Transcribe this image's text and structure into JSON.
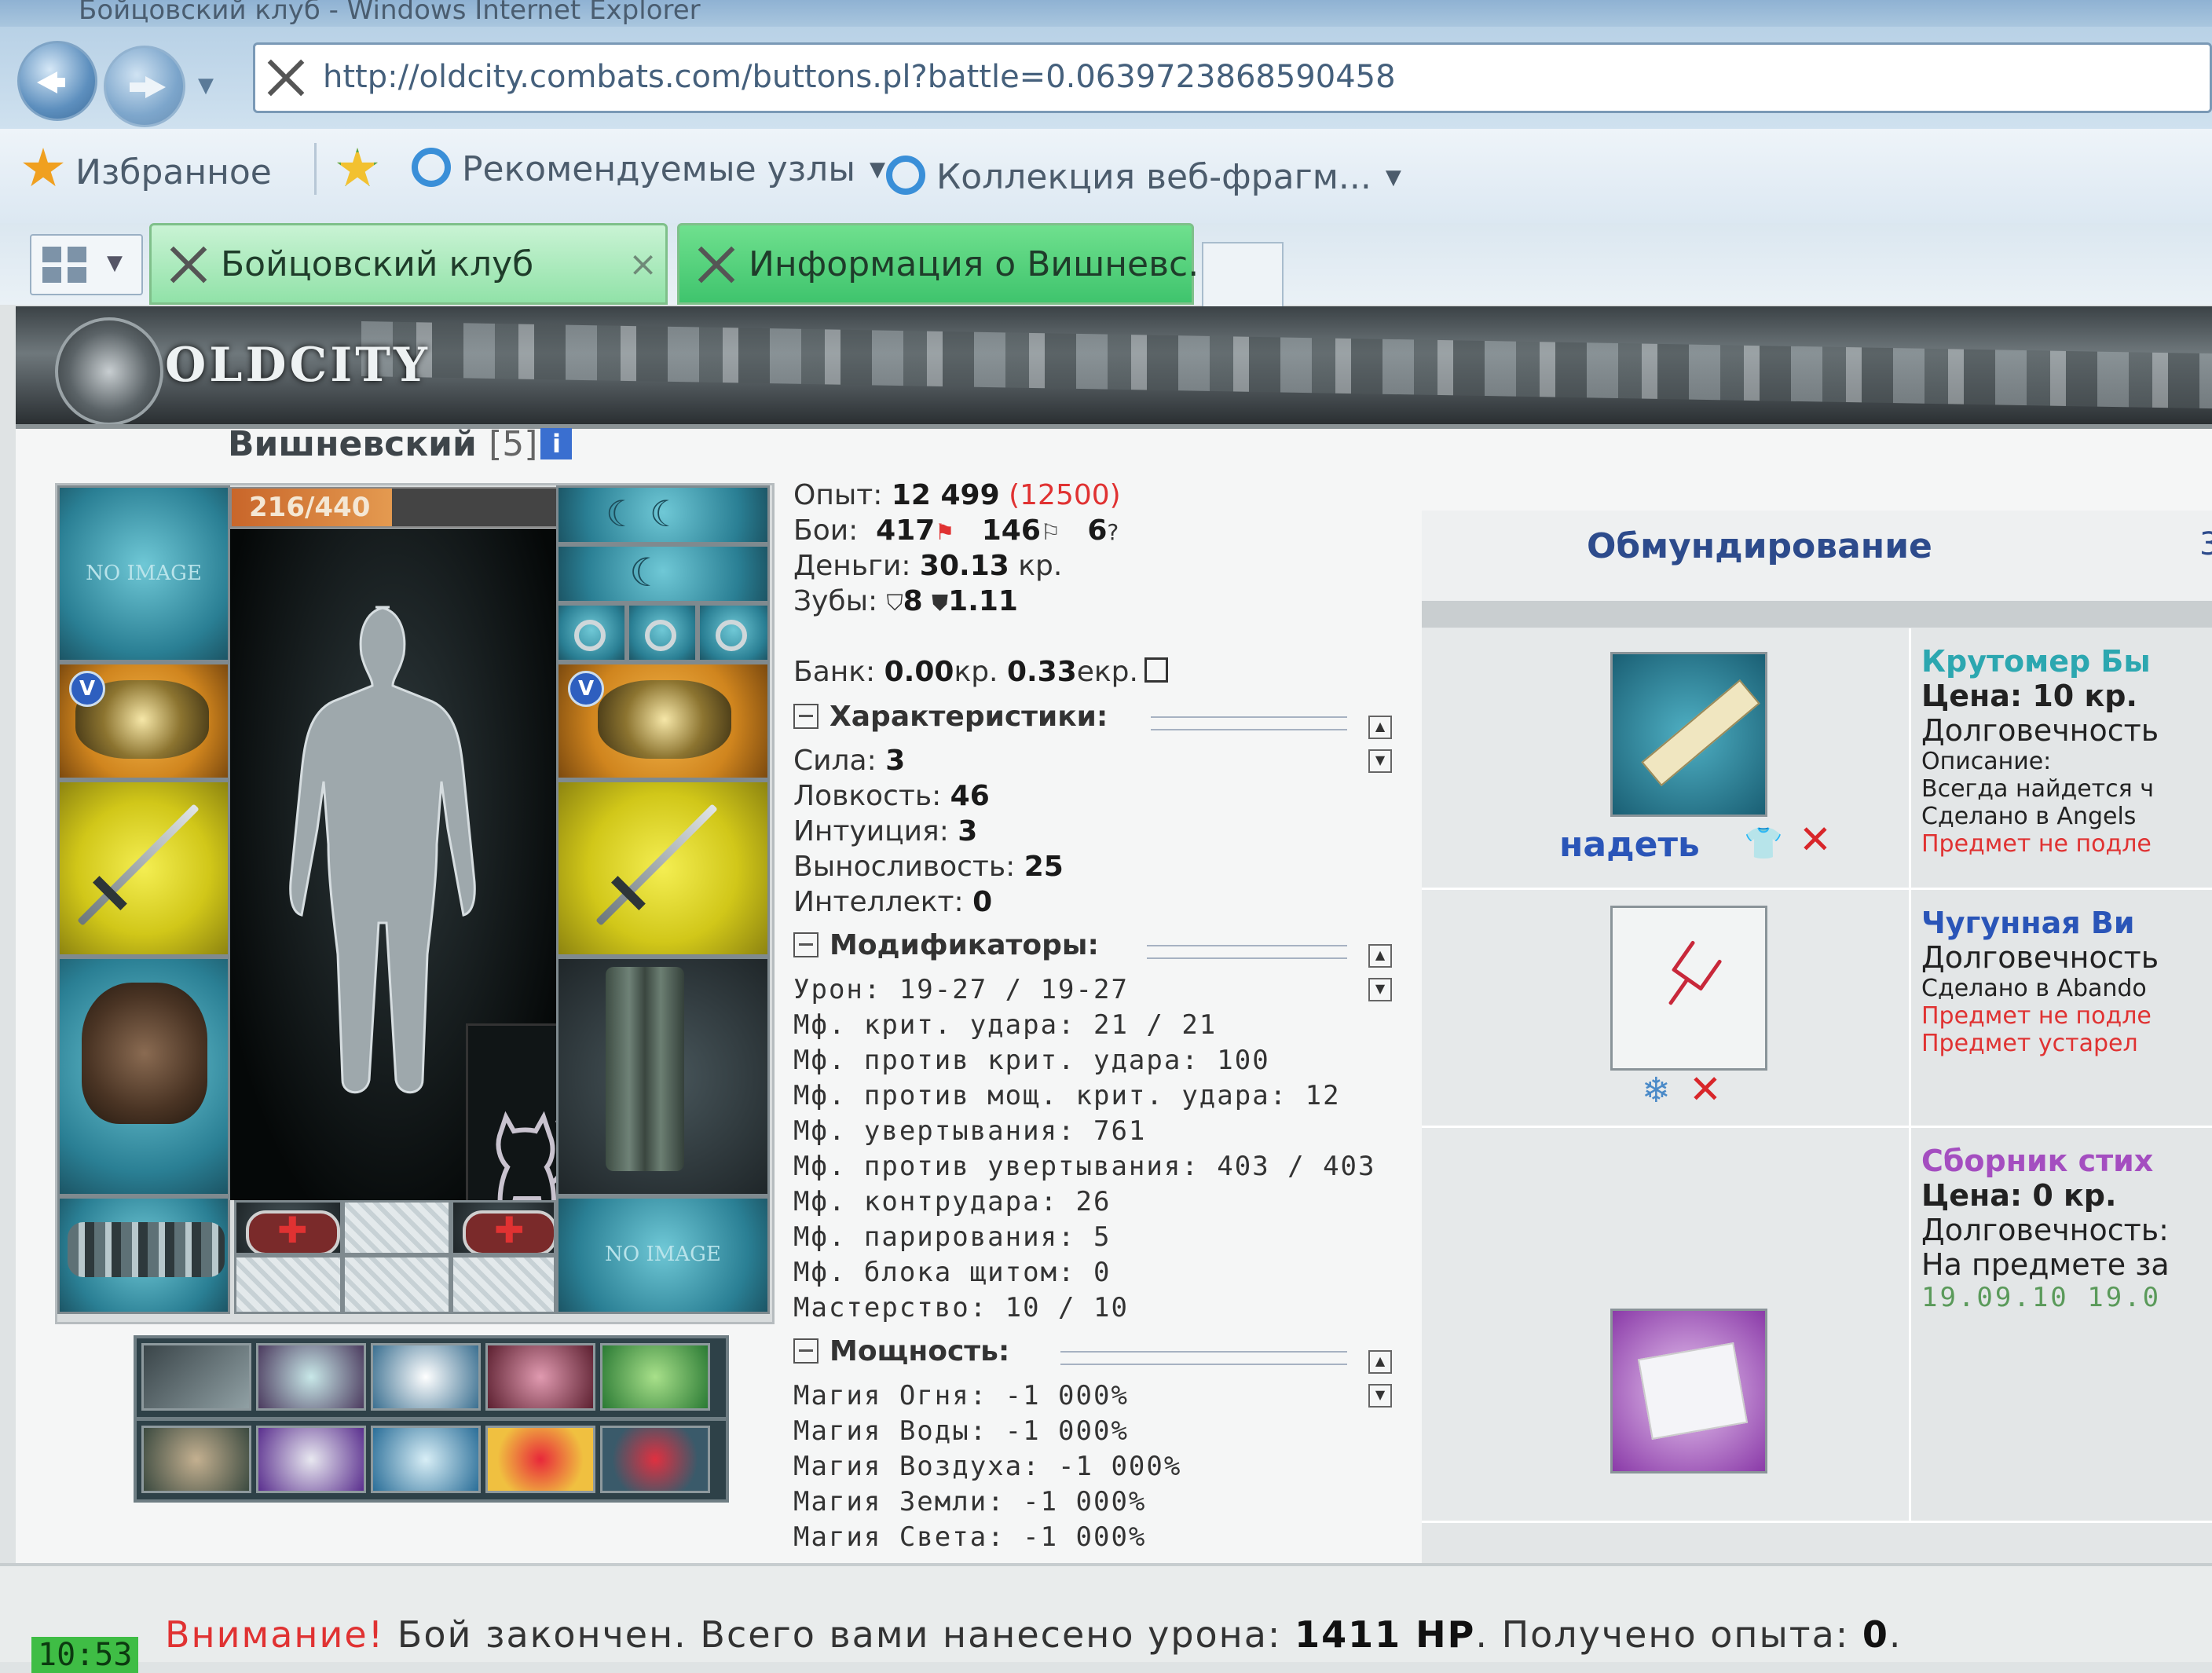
{
  "browser": {
    "window_title": "Бойцовский клуб - Windows Internet Explorer",
    "address": "http://oldcity.combats.com/buttons.pl?battle=0.0639723868590458",
    "favorites_label": "Избранное",
    "suggested_sites": "Рекомендуемые узлы",
    "web_slice_gallery": "Коллекция веб-фрагм...",
    "tabs": [
      {
        "label": "Бойцовский клуб",
        "close": "×"
      },
      {
        "label": "Информация о Вишневс..."
      }
    ]
  },
  "site": {
    "logo": "OLDCITY"
  },
  "character": {
    "name": "Вишневский",
    "level": "[5]",
    "info_icon": "i",
    "hp": "216/440",
    "hp_current": 216,
    "hp_max": 440,
    "no_image_1": "NO IMAGE",
    "no_image_2": "NO IMAGE"
  },
  "stats": {
    "exp_label": "Опыт:",
    "exp_value": "12 499",
    "exp_next": "(12500)",
    "battles_label": "Бои:",
    "wins": "417",
    "losses": "146",
    "draws": "6",
    "draws_icon": "?",
    "money_label": "Деньги:",
    "money_value": "30.13",
    "money_unit": "кр.",
    "teeth_label": "Зубы:",
    "teeth_value": "8",
    "teeth_value2": "1.11",
    "bank_label": "Банк:",
    "bank_kr": "0.00",
    "bank_kr_unit": "кр.",
    "bank_ekr": "0.33",
    "bank_ekr_unit": "екр.",
    "characteristics_title": "Характеристики:",
    "characteristics": [
      {
        "label": "Сила:",
        "value": "3"
      },
      {
        "label": "Ловкость:",
        "value": "46"
      },
      {
        "label": "Интуиция:",
        "value": "3"
      },
      {
        "label": "Выносливость:",
        "value": "25"
      },
      {
        "label": "Интеллект:",
        "value": "0"
      }
    ],
    "modifiers_title": "Модификаторы:",
    "modifiers": [
      "Урон: 19-27 / 19-27",
      "Мф. крит. удара: 21 / 21",
      "Мф. против крит. удара: 100",
      "Мф. против мощ. крит. удара: 12",
      "Мф. увертывания: 761",
      "Мф. против увертывания: 403 / 403",
      "Мф. контрудара: 26",
      "Мф. парирования: 5",
      "Мф. блока щитом: 0",
      "Мастерство: 10 / 10"
    ],
    "power_title": "Мощность:",
    "power": [
      "Магия Огня: -1 000%",
      "Магия Воды: -1 000%",
      "Магия Воздуха: -1 000%",
      "Магия Земли: -1 000%",
      "Магия Света: -1 000%"
    ]
  },
  "outfit": {
    "title": "Обмундирование",
    "header_extra": "3",
    "items": [
      {
        "name": "Крутомер Бы",
        "lines": [
          "Цена: 10 кр.",
          "Долговечность",
          "Описание:",
          "Всегда найдется ч",
          "Сделано в Angels",
          "Предмет не подле"
        ],
        "action": "надеть"
      },
      {
        "name": "Чугунная Ви",
        "lines": [
          "Долговечность",
          "Сделано в Abando",
          "Предмет не подле",
          "Предмет устарел"
        ]
      },
      {
        "name": "Сборник стих",
        "lines": [
          "Цена: 0 кр.",
          "Долговечность:",
          "На предмете за",
          "19.09.10 19.0"
        ]
      }
    ]
  },
  "status": {
    "time": "10:53",
    "warning": "Внимание!",
    "message": " Бой закончен. Всего вами нанесено урона: ",
    "damage": "1411 HP",
    "exp_text": ". Получено опыта: ",
    "exp_gained": "0",
    "end": "."
  }
}
